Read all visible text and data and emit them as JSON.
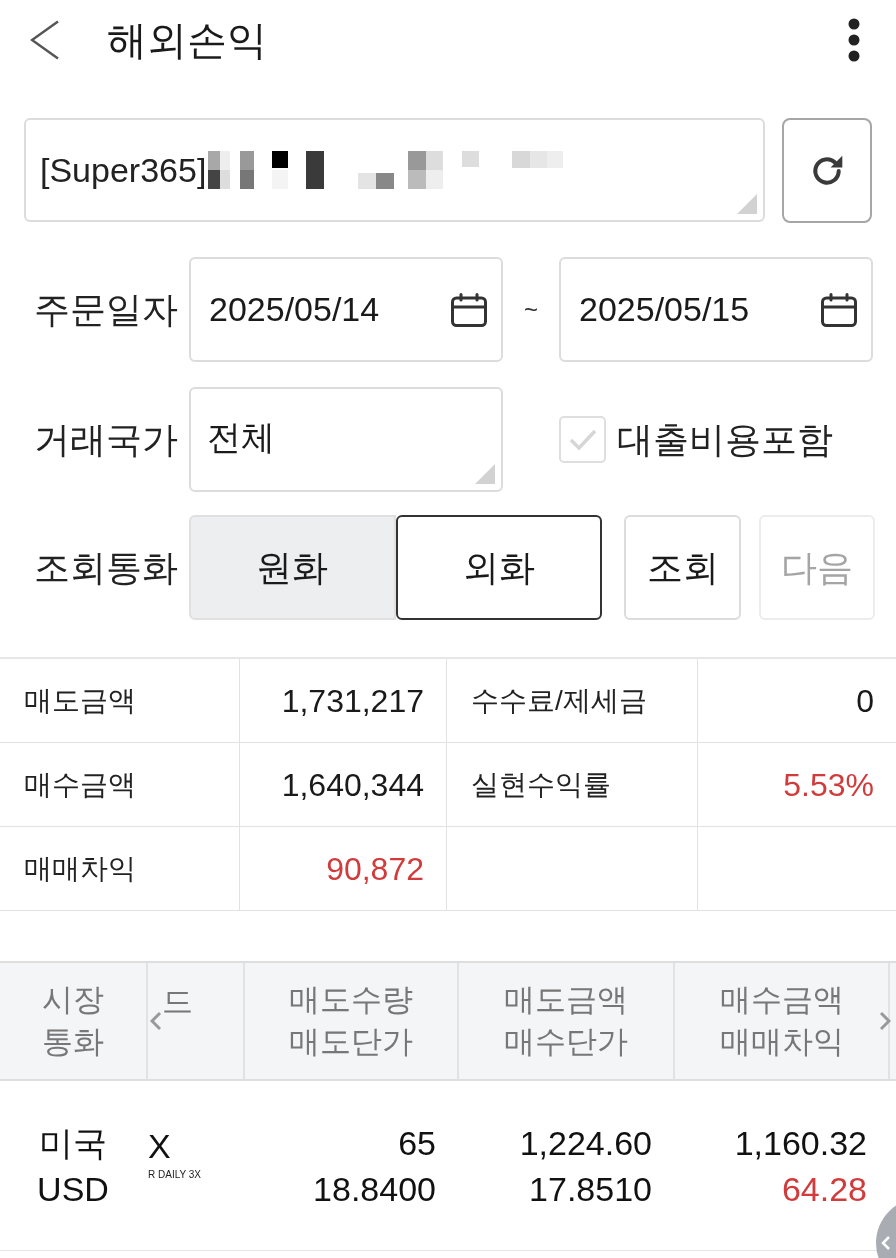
{
  "header": {
    "title": "해외손익"
  },
  "account": {
    "value": "[Super365]",
    "masked": true
  },
  "order_date": {
    "label": "주문일자",
    "from": "2025/05/14",
    "separator": "~",
    "to": "2025/05/15"
  },
  "country": {
    "label": "거래국가",
    "value": "전체"
  },
  "loan_cost": {
    "label": "대출비용포함",
    "checked": true,
    "disabled": true
  },
  "currency": {
    "label": "조회통화",
    "options": [
      {
        "label": "원화",
        "selected": false
      },
      {
        "label": "외화",
        "selected": true
      }
    ]
  },
  "actions": [
    {
      "label": "조회",
      "disabled": false
    },
    {
      "label": "다음",
      "disabled": true
    }
  ],
  "summary": {
    "rows": [
      [
        {
          "label": "매도금액",
          "value": "1,731,217",
          "positive": false
        },
        {
          "label": "수수료/제세금",
          "value": "0",
          "positive": false
        }
      ],
      [
        {
          "label": "매수금액",
          "value": "1,640,344",
          "positive": false
        },
        {
          "label": "실현수익률",
          "value": "5.53%",
          "positive": true
        }
      ],
      [
        {
          "label": "매매차익",
          "value": "90,872",
          "positive": true
        }
      ]
    ]
  },
  "trades": {
    "columns": [
      {
        "lines": [
          "시장",
          "통화"
        ]
      },
      {
        "lines": [
          "드"
        ]
      },
      {
        "lines": [
          "매도수량",
          "매도단가"
        ]
      },
      {
        "lines": [
          "매도금액",
          "매수단가"
        ]
      },
      {
        "lines": [
          "매수금액",
          "매매차익"
        ]
      }
    ],
    "rows": [
      {
        "cells": [
          {
            "kind": "text",
            "lines": [
              "미국",
              "USD"
            ]
          },
          {
            "kind": "symbol",
            "code": "X",
            "name": "R DAILY 3X"
          },
          {
            "kind": "number",
            "lines": [
              {
                "text": "65",
                "positive": false
              },
              {
                "text": "18.8400",
                "positive": false
              }
            ]
          },
          {
            "kind": "number",
            "lines": [
              {
                "text": "1,224.60",
                "positive": false
              },
              {
                "text": "17.8510",
                "positive": false
              }
            ]
          },
          {
            "kind": "number",
            "lines": [
              {
                "text": "1,160.32",
                "positive": false
              },
              {
                "text": "64.28",
                "positive": true
              }
            ]
          }
        ]
      }
    ]
  }
}
